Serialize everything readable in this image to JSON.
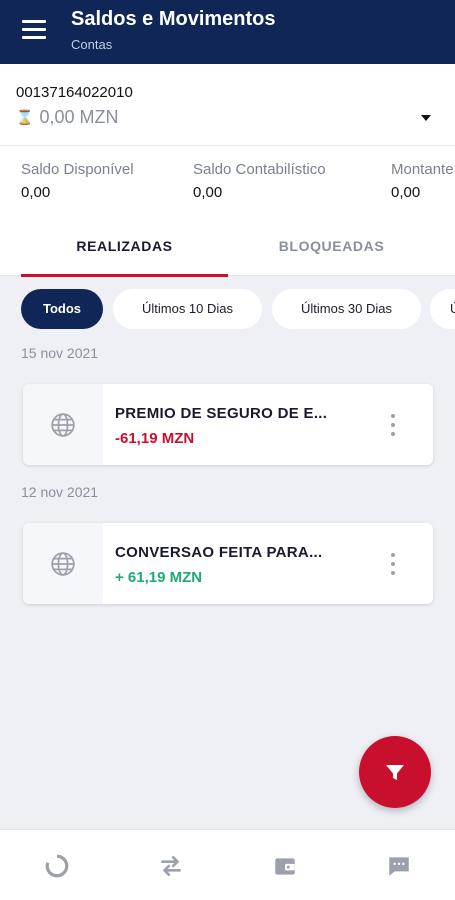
{
  "appbar": {
    "title": "Saldos e Movimentos",
    "subtitle": "Contas",
    "menu_icon": "menu-icon",
    "bg_color": "#0f2656"
  },
  "account": {
    "number": "00137164022010",
    "balance": "0,00 MZN",
    "status_icon": "hourglass-icon",
    "dropdown_icon": "dropdown-arrow-icon"
  },
  "balances": [
    {
      "label": "Saldo Disponível",
      "value": "0,00"
    },
    {
      "label": "Saldo Contabilístico",
      "value": "0,00"
    },
    {
      "label": "Montante",
      "value": "0,00"
    }
  ],
  "tabs": {
    "active": "REALIZADAS",
    "inactive": "BLOQUEADAS",
    "accent_color": "#c8102e"
  },
  "filters": [
    {
      "label": "Todos",
      "selected": true
    },
    {
      "label": "Últimos 10 Dias",
      "selected": false
    },
    {
      "label": "Últimos 30 Dias",
      "selected": false
    },
    {
      "label": "Ú",
      "selected": false
    }
  ],
  "movements": [
    {
      "date": "15 nov 2021",
      "description": "PREMIO DE SEGURO DE E...",
      "amount": "-61,19 MZN",
      "direction": "debit",
      "icon": "globe-icon",
      "amount_color": "#c8102e"
    },
    {
      "date": "12 nov 2021",
      "description": "CONVERSAO FEITA PARA...",
      "amount": "+ 61,19 MZN",
      "direction": "credit",
      "icon": "globe-icon",
      "amount_color": "#1eaa72"
    }
  ],
  "fab": {
    "icon": "filter-icon",
    "color": "#c8102e"
  },
  "bottom_nav": [
    {
      "icon": "dashboard-ring-icon"
    },
    {
      "icon": "transfer-arrows-icon"
    },
    {
      "icon": "wallet-icon"
    },
    {
      "icon": "chat-icon"
    }
  ]
}
